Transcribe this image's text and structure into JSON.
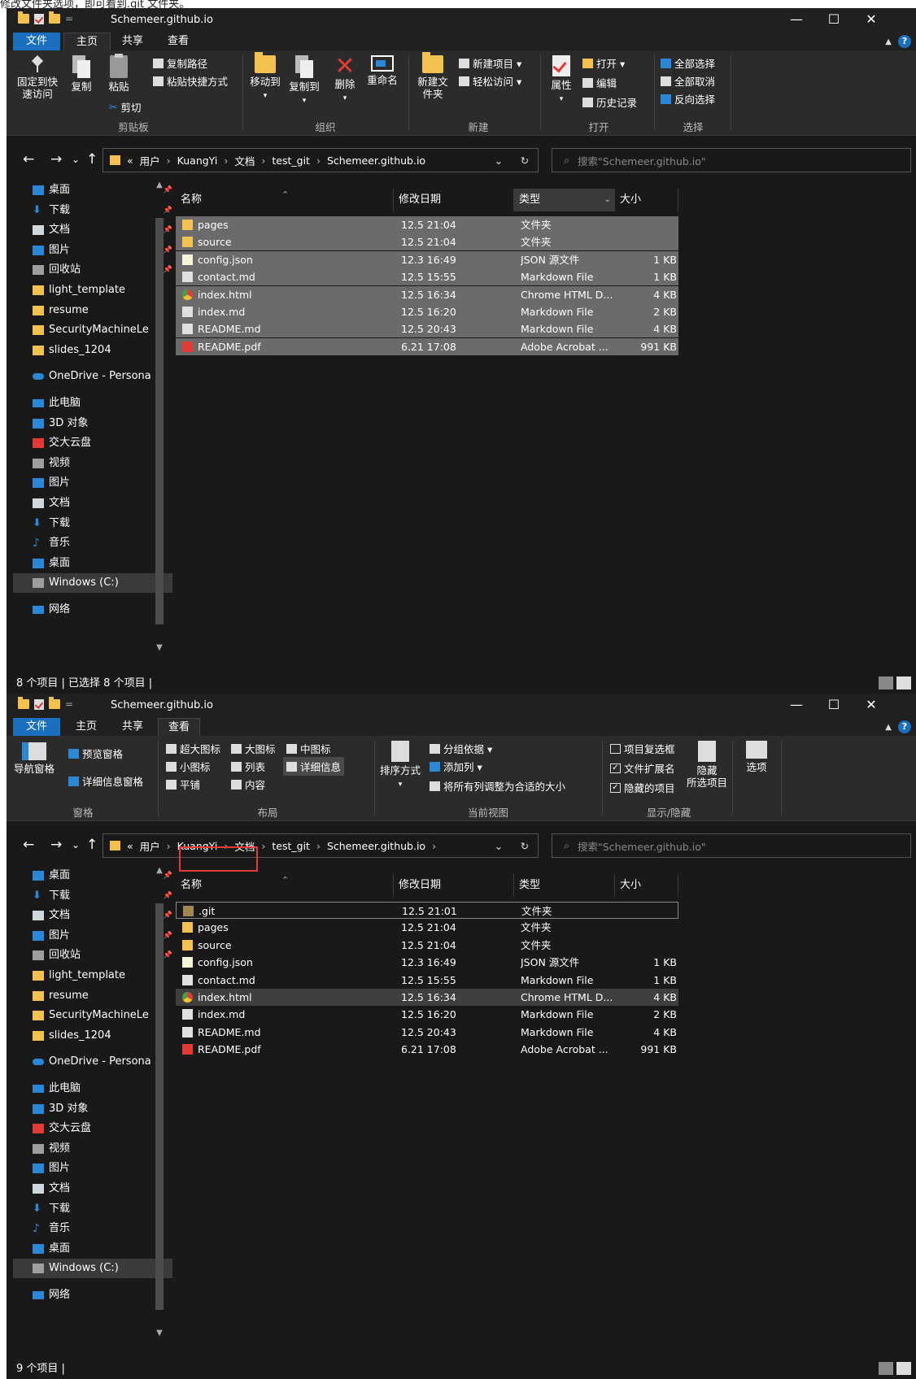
{
  "caption_fragment": "修改文件夹选项，即可看到.git 文件夹。",
  "window_title": "Schemeer.github.io",
  "qat_sep": "=",
  "controls": {
    "minimize": "—",
    "maximize": "☐",
    "close": "✕"
  },
  "menu": {
    "file": "文件",
    "home": "主页",
    "share": "共享",
    "view": "查看",
    "help": "?"
  },
  "home_ribbon": {
    "pin_label": "固定到快速访问",
    "copy": "复制",
    "paste": "粘贴",
    "copy_path": "复制路径",
    "paste_shortcut": "粘贴快捷方式",
    "cut": "剪切",
    "move_to": "移动到",
    "copy_to": "复制到",
    "delete": "删除",
    "rename": "重命名",
    "new_folder": "新建文件夹",
    "new_item": "新建项目 ▾",
    "easy_access": "轻松访问 ▾",
    "properties": "属性",
    "open": "打开 ▾",
    "edit": "编辑",
    "history": "历史记录",
    "select_all": "全部选择",
    "select_none": "全部取消",
    "invert_selection": "反向选择",
    "groups": {
      "clipboard": "剪贴板",
      "organize": "组织",
      "new": "新建",
      "open": "打开",
      "select": "选择"
    }
  },
  "view_ribbon": {
    "nav_pane": "导航窗格",
    "preview_pane": "预览窗格",
    "details_pane": "详细信息窗格",
    "xl_icons": "超大图标",
    "large_icons": "大图标",
    "medium_icons": "中图标",
    "small_icons": "小图标",
    "list": "列表",
    "details": "详细信息",
    "tiles": "平铺",
    "content": "内容",
    "sort_by": "排序方式",
    "group_by": "分组依据 ▾",
    "add_columns": "添加列 ▾",
    "fit_columns": "将所有列调整为合适的大小",
    "item_checkboxes": "项目复选框",
    "file_extensions": "文件扩展名",
    "hidden_items": "隐藏的项目",
    "hide": "隐藏",
    "hide_selected": "所选项目",
    "options": "选项",
    "groups": {
      "panes": "窗格",
      "layout": "布局",
      "current_view": "当前视图",
      "show_hide": "显示/隐藏"
    }
  },
  "address": {
    "chevrons": "«",
    "parts": [
      "用户",
      "KuangYi",
      "文档",
      "test_git",
      "Schemeer.github.io"
    ],
    "sep": "›",
    "dropdown": "⌄",
    "refresh": "↻"
  },
  "search_placeholder": "搜索\"Schemeer.github.io\"",
  "nav_buttons": {
    "back": "←",
    "forward": "→",
    "recent": "⌄",
    "up": "↑"
  },
  "nav_pane": [
    {
      "label": "桌面",
      "icon": "blue",
      "pin": true
    },
    {
      "label": "下载",
      "icon": "arrow",
      "pin": true
    },
    {
      "label": "文档",
      "icon": "doc",
      "pin": true
    },
    {
      "label": "图片",
      "icon": "blue",
      "pin": true
    },
    {
      "label": "回收站",
      "icon": "gray",
      "pin": true
    },
    {
      "label": "light_template",
      "icon": "fold"
    },
    {
      "label": "resume",
      "icon": "fold"
    },
    {
      "label": "SecurityMachineLe",
      "icon": "fold"
    },
    {
      "label": "slides_1204",
      "icon": "fold"
    },
    {
      "label": "OneDrive - Persona",
      "icon": "cloud",
      "gap": true
    },
    {
      "label": "此电脑",
      "icon": "pc",
      "gap": true
    },
    {
      "label": "3D 对象",
      "icon": "blue",
      "indent": true
    },
    {
      "label": "交大云盘",
      "icon": "red",
      "indent": true
    },
    {
      "label": "视频",
      "icon": "gray",
      "indent": true
    },
    {
      "label": "图片",
      "icon": "blue",
      "indent": true
    },
    {
      "label": "文档",
      "icon": "doc",
      "indent": true
    },
    {
      "label": "下载",
      "icon": "arrow",
      "indent": true
    },
    {
      "label": "音乐",
      "icon": "note",
      "indent": true
    },
    {
      "label": "桌面",
      "icon": "blue",
      "indent": true
    },
    {
      "label": "Windows (C:)",
      "icon": "gray",
      "indent": true,
      "selected": true
    },
    {
      "label": "网络",
      "icon": "net",
      "gap": true
    }
  ],
  "columns": {
    "name": "名称",
    "date": "修改日期",
    "type": "类型",
    "size": "大小"
  },
  "window1": {
    "files": [
      {
        "name": "pages",
        "date": "12.5 21:04",
        "type": "文件夹",
        "size": "",
        "icon": "folder",
        "selected": true
      },
      {
        "name": "source",
        "date": "12.5 21:04",
        "type": "文件夹",
        "size": "",
        "icon": "folder",
        "selected": true
      },
      {
        "name": "config.json",
        "date": "12.3 16:49",
        "type": "JSON 源文件",
        "size": "1 KB",
        "icon": "json",
        "selected": true
      },
      {
        "name": "contact.md",
        "date": "12.5 15:55",
        "type": "Markdown File",
        "size": "1 KB",
        "icon": "md",
        "selected": true
      },
      {
        "name": "index.html",
        "date": "12.5 16:34",
        "type": "Chrome HTML D...",
        "size": "4 KB",
        "icon": "chrome",
        "selected": true
      },
      {
        "name": "index.md",
        "date": "12.5 16:20",
        "type": "Markdown File",
        "size": "2 KB",
        "icon": "md",
        "selected": true
      },
      {
        "name": "README.md",
        "date": "12.5 20:43",
        "type": "Markdown File",
        "size": "4 KB",
        "icon": "md",
        "selected": true
      },
      {
        "name": "README.pdf",
        "date": "6.21 17:08",
        "type": "Adobe Acrobat ...",
        "size": "991 KB",
        "icon": "pdf",
        "selected": true
      }
    ],
    "status": "8 个项目  |  已选择 8 个项目  |"
  },
  "window2": {
    "files": [
      {
        "name": ".git",
        "date": "12.5 21:01",
        "type": "文件夹",
        "size": "",
        "icon": "gitf",
        "focus": true
      },
      {
        "name": "pages",
        "date": "12.5 21:04",
        "type": "文件夹",
        "size": "",
        "icon": "folder"
      },
      {
        "name": "source",
        "date": "12.5 21:04",
        "type": "文件夹",
        "size": "",
        "icon": "folder"
      },
      {
        "name": "config.json",
        "date": "12.3 16:49",
        "type": "JSON 源文件",
        "size": "1 KB",
        "icon": "json"
      },
      {
        "name": "contact.md",
        "date": "12.5 15:55",
        "type": "Markdown File",
        "size": "1 KB",
        "icon": "md"
      },
      {
        "name": "index.html",
        "date": "12.5 16:34",
        "type": "Chrome HTML D...",
        "size": "4 KB",
        "icon": "chrome",
        "hover": true
      },
      {
        "name": "index.md",
        "date": "12.5 16:20",
        "type": "Markdown File",
        "size": "2 KB",
        "icon": "md"
      },
      {
        "name": "README.md",
        "date": "12.5 20:43",
        "type": "Markdown File",
        "size": "4 KB",
        "icon": "md"
      },
      {
        "name": "README.pdf",
        "date": "6.21 17:08",
        "type": "Adobe Acrobat ...",
        "size": "991 KB",
        "icon": "pdf"
      }
    ],
    "status": "9 个项目  |"
  },
  "colors": {
    "accent": "#1a6fbf",
    "folder": "#f2c14e",
    "highlight_box": "#e53935"
  }
}
